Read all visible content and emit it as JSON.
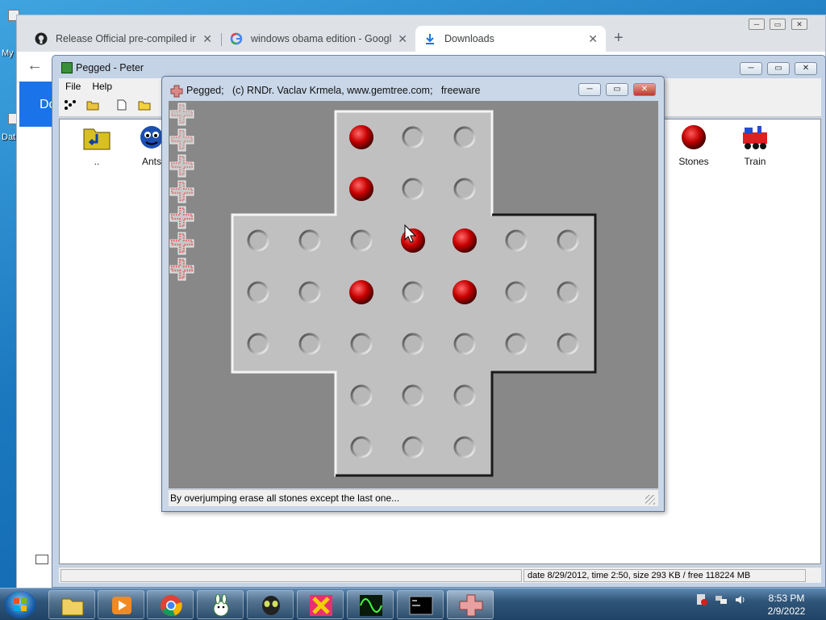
{
  "desktop": {
    "icons": [
      {
        "label": "My"
      },
      {
        "label": "Dat"
      }
    ]
  },
  "browser": {
    "tabs": [
      {
        "title": "Release Official pre-compiled ins",
        "icon": "github-icon"
      },
      {
        "title": "windows obama edition - Google",
        "icon": "google-icon"
      },
      {
        "title": "Downloads",
        "icon": "download-icon"
      }
    ],
    "page_heading_fragment": "Do"
  },
  "explorer": {
    "title": "Pegged - Peter",
    "menu": [
      "File",
      "Help"
    ],
    "items": [
      {
        "label": "..",
        "icon": "up-folder-icon"
      },
      {
        "label": "Ants",
        "icon": "ants-icon"
      },
      {
        "label": "Stones",
        "icon": "stone-icon"
      },
      {
        "label": "Train",
        "icon": "train-icon"
      }
    ],
    "status": "date 8/29/2012, time 2:50, size 293 KB / free 118224 MB"
  },
  "pegged": {
    "title": "Pegged;   (c) RNDr. Vaclav Krmela, www.gemtree.com;   freeware",
    "status": "By overjumping erase all stones except the last one...",
    "colors": {
      "background": "#888888",
      "board": "#c0c0c0",
      "stone": "#cc0000"
    },
    "board": {
      "rows": [
        "..sOO..",
        "..sOO..",
        "OOOssOO",
        "OOsOsOO",
        "OOOOOOO",
        "..OOO..",
        "..OOO.."
      ],
      "legend": {
        "s": "stone",
        "O": "empty hole",
        ".": "no cell"
      }
    }
  },
  "taskbar": {
    "apps": [
      "explorer",
      "media-player",
      "chrome",
      "rabbit-game",
      "alien-game",
      "x-game",
      "oscilloscope",
      "cmd",
      "pegged"
    ],
    "time": "8:53 PM",
    "date": "2/9/2022"
  }
}
